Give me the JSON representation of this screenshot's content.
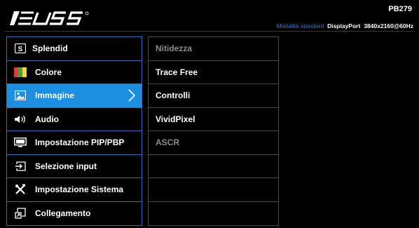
{
  "brand": "ASUS",
  "header": {
    "model": "PB279",
    "mode": "Modalità standard",
    "input": "DisplayPort",
    "resolution": "3840x2160@60Hz"
  },
  "menu": {
    "items": [
      {
        "label": "Splendid",
        "icon": "splendid-icon"
      },
      {
        "label": "Colore",
        "icon": "color-icon"
      },
      {
        "label": "Immagine",
        "icon": "image-icon",
        "active": true
      },
      {
        "label": "Audio",
        "icon": "speaker-icon"
      },
      {
        "label": "Impostazione PIP/PBP",
        "icon": "monitor-icon"
      },
      {
        "label": "Selezione input",
        "icon": "input-icon"
      },
      {
        "label": "Impostazione Sistema",
        "icon": "tools-icon"
      },
      {
        "label": "Collegamento",
        "icon": "shortcut-icon"
      }
    ]
  },
  "submenu": {
    "items": [
      {
        "label": "Nitidezza",
        "enabled": false
      },
      {
        "label": "Trace Free",
        "enabled": true
      },
      {
        "label": "Controlli",
        "enabled": true
      },
      {
        "label": "VividPixel",
        "enabled": true
      },
      {
        "label": "ASCR",
        "enabled": false
      },
      {
        "label": "",
        "enabled": false
      },
      {
        "label": "",
        "enabled": false
      },
      {
        "label": "",
        "enabled": false
      }
    ]
  },
  "colors": {
    "accent": "#1c8fe0",
    "border": "#2f6ead",
    "mode_text": "#2f7ac0",
    "disabled_text": "#8a8a8a"
  }
}
